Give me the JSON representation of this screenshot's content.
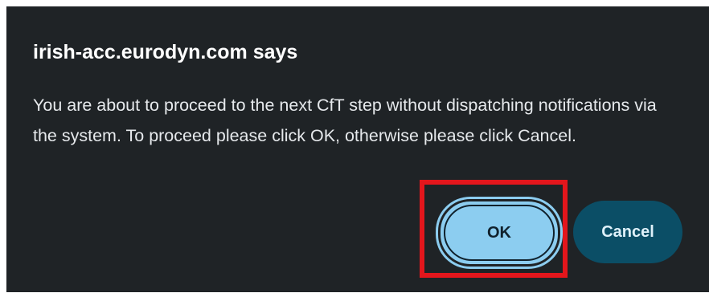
{
  "dialog": {
    "title": "irish-acc.eurodyn.com says",
    "message": "You are about to proceed to the next CfT step without dispatching notifications via the system. To proceed please click OK, otherwise please click Cancel.",
    "ok_label": "OK",
    "cancel_label": "Cancel"
  },
  "colors": {
    "dialog_background": "#1f2326",
    "ok_button": "#8ccdf0",
    "cancel_button": "#0b4e66",
    "highlight_box": "#e3161c"
  }
}
